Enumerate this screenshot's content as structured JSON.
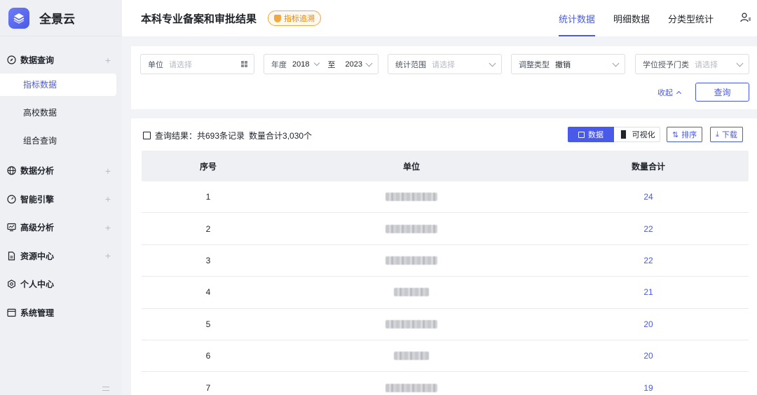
{
  "app": {
    "title": "全景云"
  },
  "sidebar": {
    "groups": [
      {
        "label": "数据查询",
        "icon": "compass-icon",
        "expanded": true,
        "items": [
          {
            "label": "指标数据",
            "active": true
          },
          {
            "label": "高校数据",
            "active": false
          },
          {
            "label": "组合查询",
            "active": false
          }
        ]
      },
      {
        "label": "数据分析",
        "icon": "globe-icon"
      },
      {
        "label": "智能引擎",
        "icon": "gauge-icon"
      },
      {
        "label": "高级分析",
        "icon": "monitor-chart-icon"
      },
      {
        "label": "资源中心",
        "icon": "document-icon"
      },
      {
        "label": "个人中心",
        "icon": "gear-icon"
      },
      {
        "label": "系统管理",
        "icon": "window-icon"
      }
    ]
  },
  "header": {
    "title": "本科专业备案和审批结果",
    "badge": "指标追溯",
    "tabs": [
      {
        "label": "统计数据",
        "active": true
      },
      {
        "label": "明细数据",
        "active": false
      },
      {
        "label": "分类型统计",
        "active": false
      }
    ]
  },
  "filters": {
    "unit": {
      "label": "单位",
      "placeholder": "请选择"
    },
    "year": {
      "label": "年度",
      "from": "2018",
      "sep": "至",
      "to": "2023"
    },
    "scope": {
      "label": "统计范围",
      "placeholder": "请选择"
    },
    "adjust_type": {
      "label": "调整类型",
      "value": "撤销"
    },
    "degree_category": {
      "label": "学位授予门类",
      "placeholder": "请选择"
    },
    "collapse_label": "收起",
    "query_label": "查询"
  },
  "result": {
    "summary": "查询结果：共693条记录",
    "total": "数量合计3,030个",
    "view_data": "数据",
    "view_chart": "可视化",
    "sort": "排序",
    "download": "下载",
    "columns": [
      "序号",
      "单位",
      "数量合计"
    ],
    "rows": [
      {
        "index": "1",
        "count": "24"
      },
      {
        "index": "2",
        "count": "22"
      },
      {
        "index": "3",
        "count": "22"
      },
      {
        "index": "4",
        "count": "21"
      },
      {
        "index": "5",
        "count": "20"
      },
      {
        "index": "6",
        "count": "20"
      },
      {
        "index": "7",
        "count": "19"
      }
    ]
  },
  "colors": {
    "accent": "#4a5ae8",
    "badge": "#f0a840"
  }
}
